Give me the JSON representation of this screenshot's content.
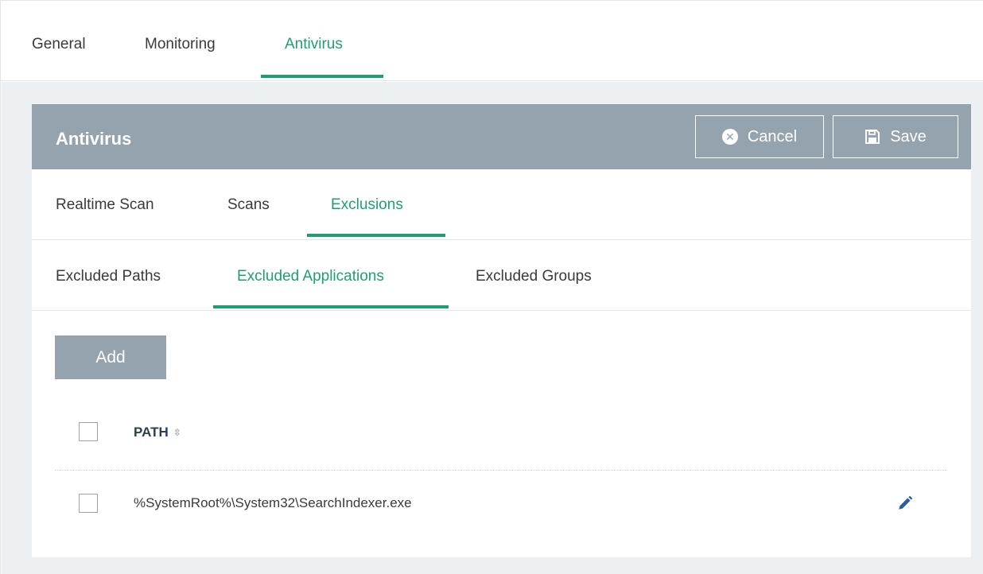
{
  "top_tabs": [
    {
      "label": "General"
    },
    {
      "label": "Monitoring"
    },
    {
      "label": "Antivirus"
    }
  ],
  "panel": {
    "title": "Antivirus",
    "cancel_label": "Cancel",
    "save_label": "Save"
  },
  "sub_tabs": [
    {
      "label": "Realtime Scan"
    },
    {
      "label": "Scans"
    },
    {
      "label": "Exclusions"
    }
  ],
  "exclusion_tabs": [
    {
      "label": "Excluded Paths"
    },
    {
      "label": "Excluded Applications"
    },
    {
      "label": "Excluded Groups"
    }
  ],
  "toolbar": {
    "add_label": "Add"
  },
  "table": {
    "columns": [
      {
        "label": "PATH"
      }
    ],
    "rows": [
      {
        "path": "%SystemRoot%\\System32\\SearchIndexer.exe"
      }
    ]
  },
  "icons": {
    "cancel": "x-circle-icon",
    "save": "floppy-disk-icon",
    "sort": "sort-icon",
    "edit": "pencil-icon"
  },
  "colors": {
    "accent": "#1f9e76",
    "header": "#94a3ad",
    "background": "#ecf0f2"
  }
}
